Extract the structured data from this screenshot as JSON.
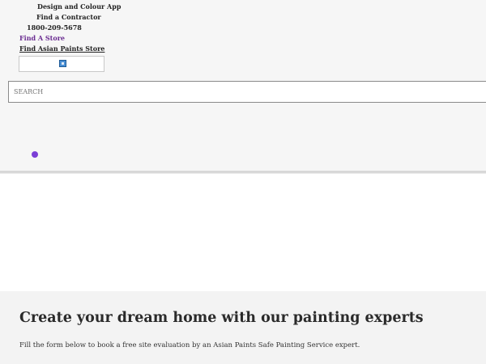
{
  "header": {
    "links": {
      "design_app": "Design and Colour App",
      "find_contractor": "Find a Contractor",
      "phone": "1800-209-5678",
      "find_store": "Find A Store",
      "find_asian_store": "Find Asian Paints Store"
    },
    "language_icon": "language-selector-icon"
  },
  "search": {
    "placeholder": "SEARCH",
    "value": ""
  },
  "hero": {
    "title": "Create your dream home with our painting experts",
    "subtitle": "Fill the form below to book a free site evaluation by an Asian Paints Safe Painting Service expert."
  },
  "colors": {
    "accent_purple": "#6a2c91",
    "dot_purple": "#7b3fd6",
    "top_background": "#f6f6f6",
    "hero_background": "#f3f3f3"
  }
}
